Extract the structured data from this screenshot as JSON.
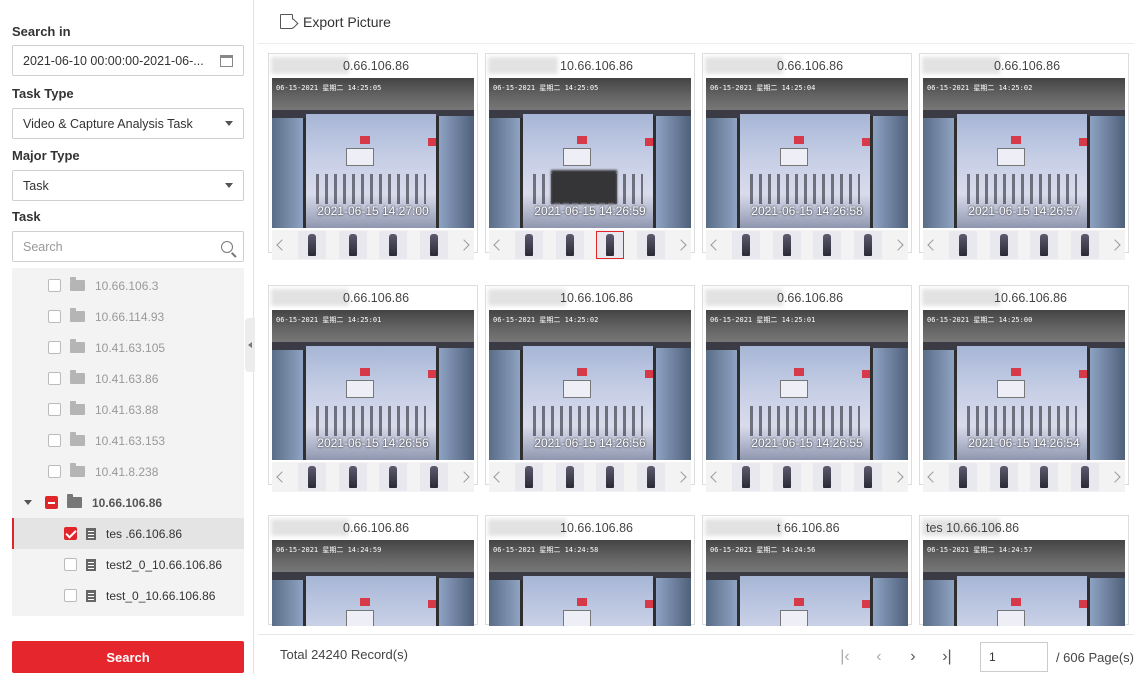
{
  "left_panel": {
    "search_in_label": "Search in",
    "date_range_value": "2021-06-10 00:00:00-2021-06-...",
    "task_type_label": "Task Type",
    "task_type_value": "Video & Capture Analysis Task",
    "major_type_label": "Major Type",
    "major_type_value": "Task",
    "task_label": "Task",
    "task_search_placeholder": "Search",
    "tree": [
      {
        "label": "10.66.106.3"
      },
      {
        "label": "10.66.114.93"
      },
      {
        "label": "10.41.63.105"
      },
      {
        "label": "10.41.63.86"
      },
      {
        "label": "10.41.63.88"
      },
      {
        "label": "10.41.63.153"
      },
      {
        "label": "10.41.8.238"
      },
      {
        "label": "10.66.106.86"
      },
      {
        "label": "tes        .66.106.86"
      },
      {
        "label": "test2_0_10.66.106.86"
      },
      {
        "label": "test_0_10.66.106.86"
      }
    ],
    "search_button": "Search"
  },
  "toolbar": {
    "export_label": "Export Picture"
  },
  "cards": [
    {
      "title": "0.66.106.86",
      "stamp": "06-15-2021 星期二 14:25:05",
      "time": "2021-06-15 14:27:00"
    },
    {
      "title": "10.66.106.86",
      "stamp": "06-15-2021 星期二 14:25:05",
      "time": "2021-06-15 14:26:59"
    },
    {
      "title": "0.66.106.86",
      "stamp": "06-15-2021 星期二 14:25:04",
      "time": "2021-06-15 14:26:58"
    },
    {
      "title": "0.66.106.86",
      "stamp": "06-15-2021 星期二 14:25:02",
      "time": "2021-06-15 14:26:57"
    },
    {
      "title": "0.66.106.86",
      "stamp": "06-15-2021 星期二 14:25:01",
      "time": "2021-06-15 14:26:56"
    },
    {
      "title": "10.66.106.86",
      "stamp": "06-15-2021 星期二 14:25:02",
      "time": "2021-06-15 14:26:56"
    },
    {
      "title": "0.66.106.86",
      "stamp": "06-15-2021 星期二 14:25:01",
      "time": "2021-06-15 14:26:55"
    },
    {
      "title": "10.66.106.86",
      "stamp": "06-15-2021 星期二 14:25:00",
      "time": "2021-06-15 14:26:54"
    },
    {
      "title": "0.66.106.86",
      "stamp": "06-15-2021 星期二 14:24:59",
      "time": ""
    },
    {
      "title": "10.66.106.86",
      "stamp": "06-15-2021 星期二 14:24:58",
      "time": ""
    },
    {
      "title": "t        66.106.86",
      "stamp": "06-15-2021 星期二 14:24:56",
      "time": ""
    },
    {
      "title": "tes        10.66.106.86",
      "stamp": "06-15-2021 星期二 14:24:57",
      "time": ""
    }
  ],
  "footer": {
    "total": "Total 24240 Record(s)",
    "page_value": "1",
    "page_total": "/ 606 Page(s)"
  }
}
